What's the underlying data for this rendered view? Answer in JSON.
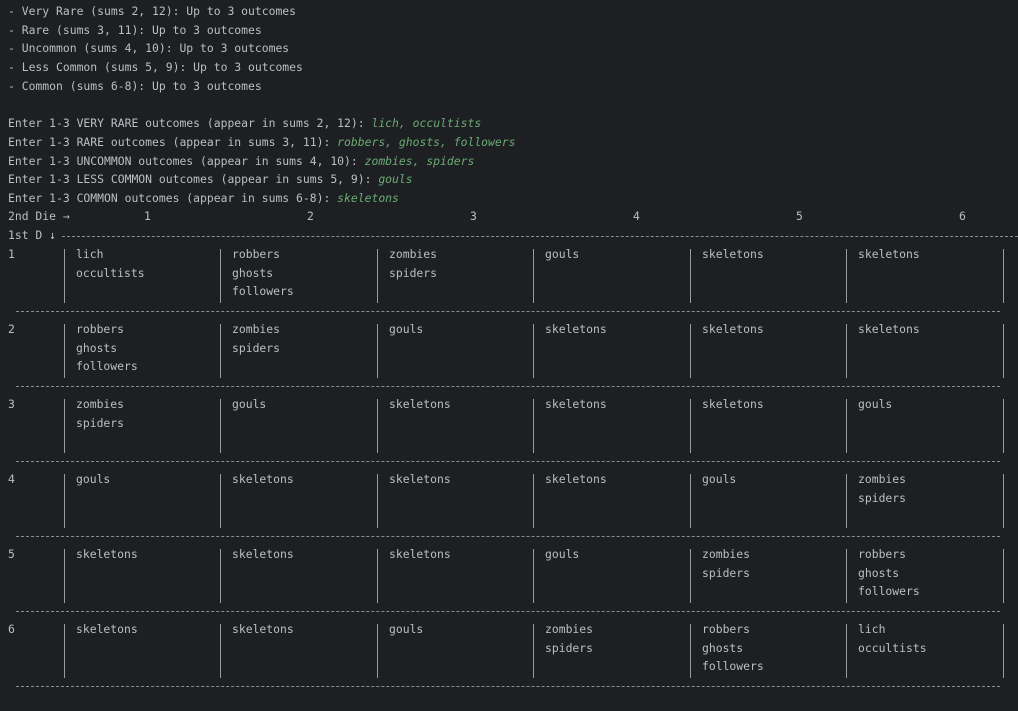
{
  "rarity_legend": [
    "- Very Rare (sums 2, 12): Up to 3 outcomes",
    "- Rare (sums 3, 11): Up to 3 outcomes",
    "- Uncommon (sums 4, 10): Up to 3 outcomes",
    "- Less Common (sums 5, 9): Up to 3 outcomes",
    "- Common (sums 6-8): Up to 3 outcomes"
  ],
  "prompts": [
    {
      "prompt": "Enter 1-3 VERY RARE outcomes (appear in sums 2, 12): ",
      "input": "lich, occultists"
    },
    {
      "prompt": "Enter 1-3 RARE outcomes (appear in sums 3, 11): ",
      "input": "robbers, ghosts, followers"
    },
    {
      "prompt": "Enter 1-3 UNCOMMON outcomes (appear in sums 4, 10): ",
      "input": "zombies, spiders"
    },
    {
      "prompt": "Enter 1-3 LESS COMMON outcomes (appear in sums 5, 9): ",
      "input": "gouls"
    },
    {
      "prompt": "Enter 1-3 COMMON outcomes (appear in sums 6-8): ",
      "input": "skeletons"
    }
  ],
  "table": {
    "col_axis_label": "2nd Die →",
    "row_axis_label": "1st D ↓",
    "col_headers": [
      "1",
      "2",
      "3",
      "4",
      "5",
      "6"
    ],
    "rows": [
      {
        "label": "1",
        "cells": [
          [
            "lich",
            "occultists"
          ],
          [
            "robbers",
            "ghosts",
            "followers"
          ],
          [
            "zombies",
            "spiders"
          ],
          [
            "gouls"
          ],
          [
            "skeletons"
          ],
          [
            "skeletons"
          ]
        ]
      },
      {
        "label": "2",
        "cells": [
          [
            "robbers",
            "ghosts",
            "followers"
          ],
          [
            "zombies",
            "spiders"
          ],
          [
            "gouls"
          ],
          [
            "skeletons"
          ],
          [
            "skeletons"
          ],
          [
            "skeletons"
          ]
        ]
      },
      {
        "label": "3",
        "cells": [
          [
            "zombies",
            "spiders"
          ],
          [
            "gouls"
          ],
          [
            "skeletons"
          ],
          [
            "skeletons"
          ],
          [
            "skeletons"
          ],
          [
            "gouls"
          ]
        ]
      },
      {
        "label": "4",
        "cells": [
          [
            "gouls"
          ],
          [
            "skeletons"
          ],
          [
            "skeletons"
          ],
          [
            "skeletons"
          ],
          [
            "gouls"
          ],
          [
            "zombies",
            "spiders"
          ]
        ]
      },
      {
        "label": "5",
        "cells": [
          [
            "skeletons"
          ],
          [
            "skeletons"
          ],
          [
            "skeletons"
          ],
          [
            "gouls"
          ],
          [
            "zombies",
            "spiders"
          ],
          [
            "robbers",
            "ghosts",
            "followers"
          ]
        ]
      },
      {
        "label": "6",
        "cells": [
          [
            "skeletons"
          ],
          [
            "skeletons"
          ],
          [
            "gouls"
          ],
          [
            "zombies",
            "spiders"
          ],
          [
            "robbers",
            "ghosts",
            "followers"
          ],
          [
            "lich",
            "occultists"
          ]
        ]
      }
    ]
  },
  "colors": {
    "background": "#1e1f22",
    "text": "#bcbec4",
    "input_text": "#6aab73"
  }
}
